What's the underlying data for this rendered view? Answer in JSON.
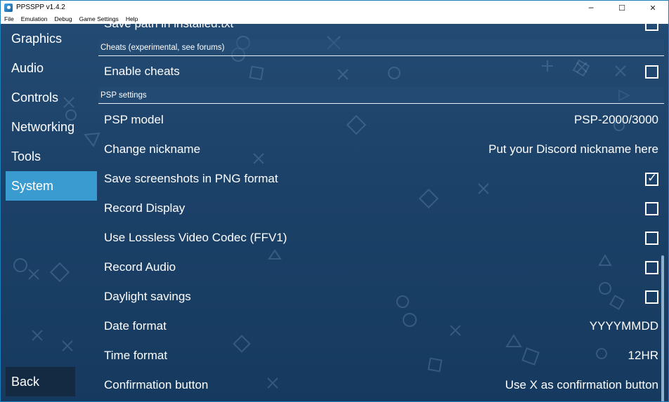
{
  "window": {
    "title": "PPSSPP v1.4.2",
    "controls": {
      "minimize": "─",
      "maximize": "☐",
      "close": "✕"
    }
  },
  "menu": [
    "File",
    "Emulation",
    "Debug",
    "Game Settings",
    "Help"
  ],
  "sidebar": {
    "items": [
      {
        "label": "Graphics",
        "active": false
      },
      {
        "label": "Audio",
        "active": false
      },
      {
        "label": "Controls",
        "active": false
      },
      {
        "label": "Networking",
        "active": false
      },
      {
        "label": "Tools",
        "active": false
      },
      {
        "label": "System",
        "active": true
      }
    ],
    "back_label": "Back"
  },
  "settings": {
    "partial_top": {
      "label": "Save path in installed.txt",
      "checked": false
    },
    "cheats_header": "Cheats (experimental, see forums)",
    "enable_cheats": {
      "label": "Enable cheats",
      "checked": false
    },
    "psp_header": "PSP settings",
    "rows": [
      {
        "label": "PSP model",
        "type": "value",
        "value": "PSP-2000/3000"
      },
      {
        "label": "Change nickname",
        "type": "value",
        "value": "Put your Discord nickname here"
      },
      {
        "label": "Save screenshots in PNG format",
        "type": "checkbox",
        "checked": true
      },
      {
        "label": "Record Display",
        "type": "checkbox",
        "checked": false
      },
      {
        "label": "Use Lossless Video Codec (FFV1)",
        "type": "checkbox",
        "checked": false
      },
      {
        "label": "Record Audio",
        "type": "checkbox",
        "checked": false
      },
      {
        "label": "Daylight savings",
        "type": "checkbox",
        "checked": false
      },
      {
        "label": "Date format",
        "type": "value",
        "value": "YYYYMMDD"
      },
      {
        "label": "Time format",
        "type": "value",
        "value": "12HR"
      },
      {
        "label": "Confirmation button",
        "type": "value",
        "value": "Use X as confirmation button"
      }
    ]
  },
  "colors": {
    "accent": "#3a9bd0",
    "background_top": "#234a72",
    "background_bottom": "#163a5f"
  }
}
